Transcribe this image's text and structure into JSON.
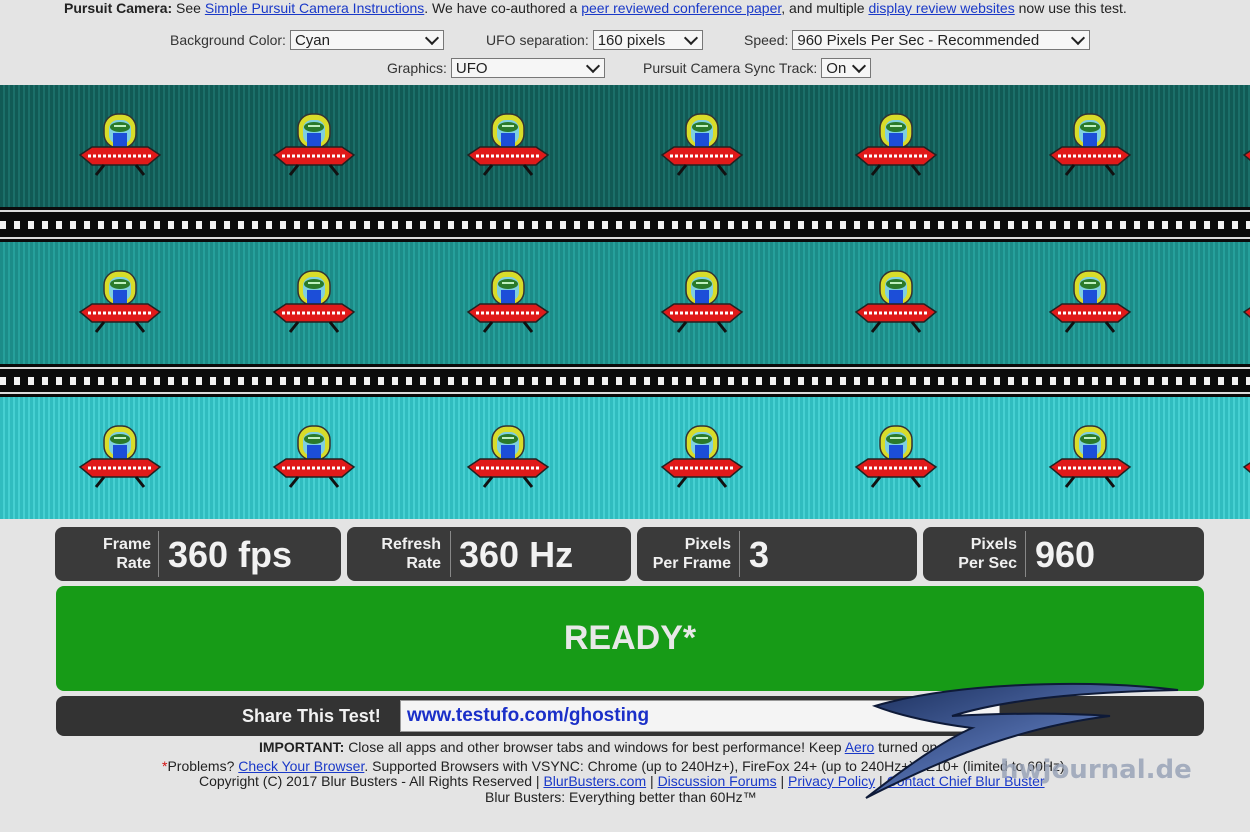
{
  "header": {
    "label": "Pursuit Camera:",
    "see": "See",
    "link1": "Simple Pursuit Camera Instructions",
    "mid": ". We have co-authored a",
    "link2": "peer reviewed conference paper",
    "mid2": ", and multiple",
    "link3": "display review websites",
    "tail": "now use this test."
  },
  "controls": {
    "background_color": {
      "label": "Background Color:",
      "value": "Cyan"
    },
    "ufo_separation": {
      "label": "UFO separation:",
      "value": "160 pixels"
    },
    "speed": {
      "label": "Speed:",
      "value": "960 Pixels Per Sec - Recommended"
    },
    "graphics": {
      "label": "Graphics:",
      "value": "UFO"
    },
    "sync_track": {
      "label": "Pursuit Camera Sync Track:",
      "value": "On"
    }
  },
  "lanes": [
    {
      "color": "#115a55",
      "color2": "#1b6f69"
    },
    {
      "color": "#1c8c88",
      "color2": "#26a09b"
    },
    {
      "color": "#30bcbf",
      "color2": "#46d0d2"
    }
  ],
  "stats": [
    {
      "label1": "Frame",
      "label2": "Rate",
      "value": "360 fps"
    },
    {
      "label1": "Refresh",
      "label2": "Rate",
      "value": "360 Hz"
    },
    {
      "label1": "Pixels",
      "label2": "Per Frame",
      "value": "3"
    },
    {
      "label1": "Pixels",
      "label2": "Per Sec",
      "value": "960"
    }
  ],
  "status": "READY*",
  "share": {
    "label": "Share This Test!",
    "url": "www.testufo.com/ghosting"
  },
  "footer": {
    "important_bold": "IMPORTANT:",
    "important_text": "Close all apps and other browser tabs and windows for best performance! Keep",
    "important_link": "Aero",
    "important_tail": "turned on.",
    "problems_star": "*",
    "problems": "Problems?",
    "check_browser": "Check Your Browser",
    "supported": ". Supported Browsers with VSYNC: Chrome (up to 240Hz+), FireFox 24+ (up to 240Hz+), IE10+ (limited to 60Hz)",
    "copyright": "Copyright (C) 2017 Blur Busters - All Rights Reserved |",
    "links": [
      "BlurBusters.com",
      "Discussion Forums",
      "Privacy Policy",
      "Contact Chief Blur Buster"
    ],
    "tagline": "Blur Busters: Everything better than 60Hz™"
  },
  "watermark": "hwjournal.de",
  "colors": {
    "ufo_saucer": "#e01a1a",
    "ufo_dome": "#d8dc2a",
    "ufo_alien": "#2a7a2a",
    "ufo_pilot": "#1c4ed8",
    "ready_green": "#179b17",
    "panel_dark": "#3a3a3a"
  }
}
